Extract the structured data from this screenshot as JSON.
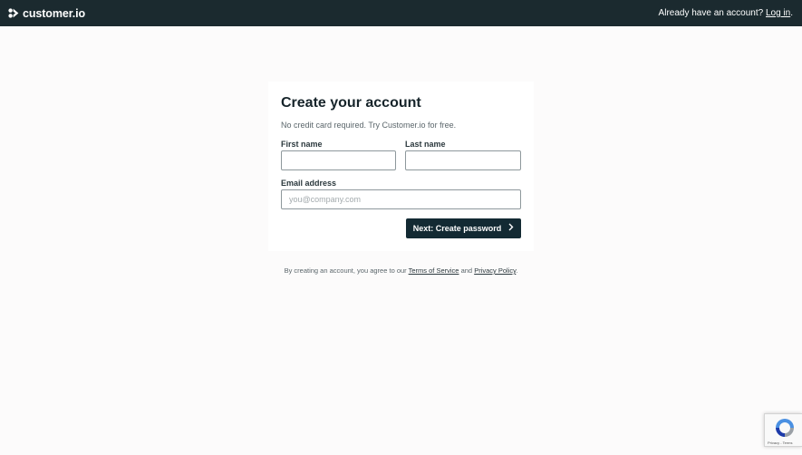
{
  "header": {
    "brand_name": "customer.io",
    "login_prompt": "Already have an account?",
    "login_link": "Log in",
    "login_suffix": "."
  },
  "form": {
    "title": "Create your account",
    "subtitle": "No credit card required. Try Customer.io for free.",
    "first_name_label": "First name",
    "first_name_value": "",
    "last_name_label": "Last name",
    "last_name_value": "",
    "email_label": "Email address",
    "email_placeholder": "you@company.com",
    "email_value": "",
    "next_button": "Next: Create password"
  },
  "legal": {
    "prefix": "By creating an account, you agree to our",
    "terms_link": "Terms of Service",
    "conjunction": "and",
    "privacy_link": "Privacy Policy",
    "suffix": "."
  },
  "recaptcha": {
    "privacy": "Privacy",
    "separator": " - ",
    "terms": "Terms"
  },
  "colors": {
    "header_bg": "#1b2a2f",
    "page_bg": "#fcfbfb",
    "button_bg": "#132a33"
  },
  "icons": {
    "logo": "customerio-logo-icon",
    "next": "chevron-right-icon",
    "recaptcha": "recaptcha-icon"
  }
}
